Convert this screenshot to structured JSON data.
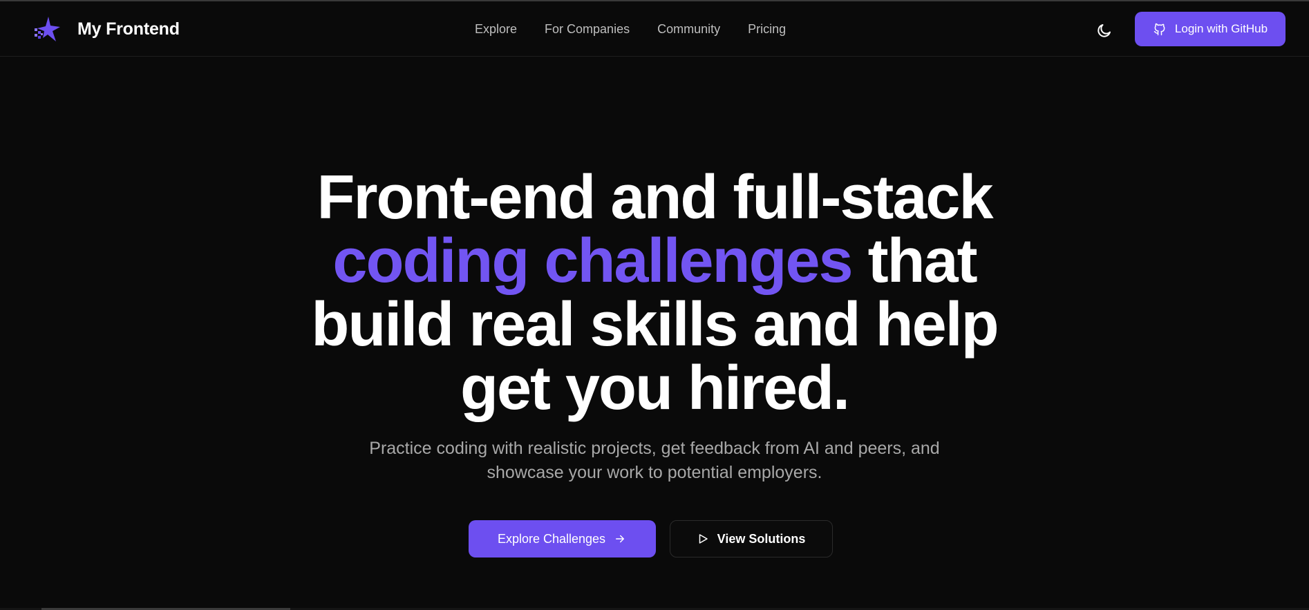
{
  "brand": {
    "name": "My Frontend",
    "logo_icon": "star-logo-icon"
  },
  "nav": {
    "items": [
      {
        "label": "Explore"
      },
      {
        "label": "For Companies"
      },
      {
        "label": "Community"
      },
      {
        "label": "Pricing"
      }
    ]
  },
  "header": {
    "theme_toggle_icon": "moon-icon",
    "login_label": "Login with GitHub",
    "login_icon": "github-icon"
  },
  "hero": {
    "line1": "Front-end and full-stack",
    "line2_accent": "coding challenges",
    "line2_rest": " that",
    "line3": "build real skills and help",
    "line4": "get you hired.",
    "subtitle_line1": "Practice coding with realistic projects, get feedback from AI and peers, and",
    "subtitle_line2": "showcase your work to potential employers."
  },
  "cta": {
    "primary_label": "Explore Challenges",
    "primary_icon": "arrow-right-icon",
    "secondary_label": "View Solutions",
    "secondary_icon": "play-icon"
  },
  "colors": {
    "background": "#0a0a0a",
    "accent": "#6d4ff0",
    "accent_text": "#7255f2",
    "muted_text": "#a8a8a8"
  }
}
